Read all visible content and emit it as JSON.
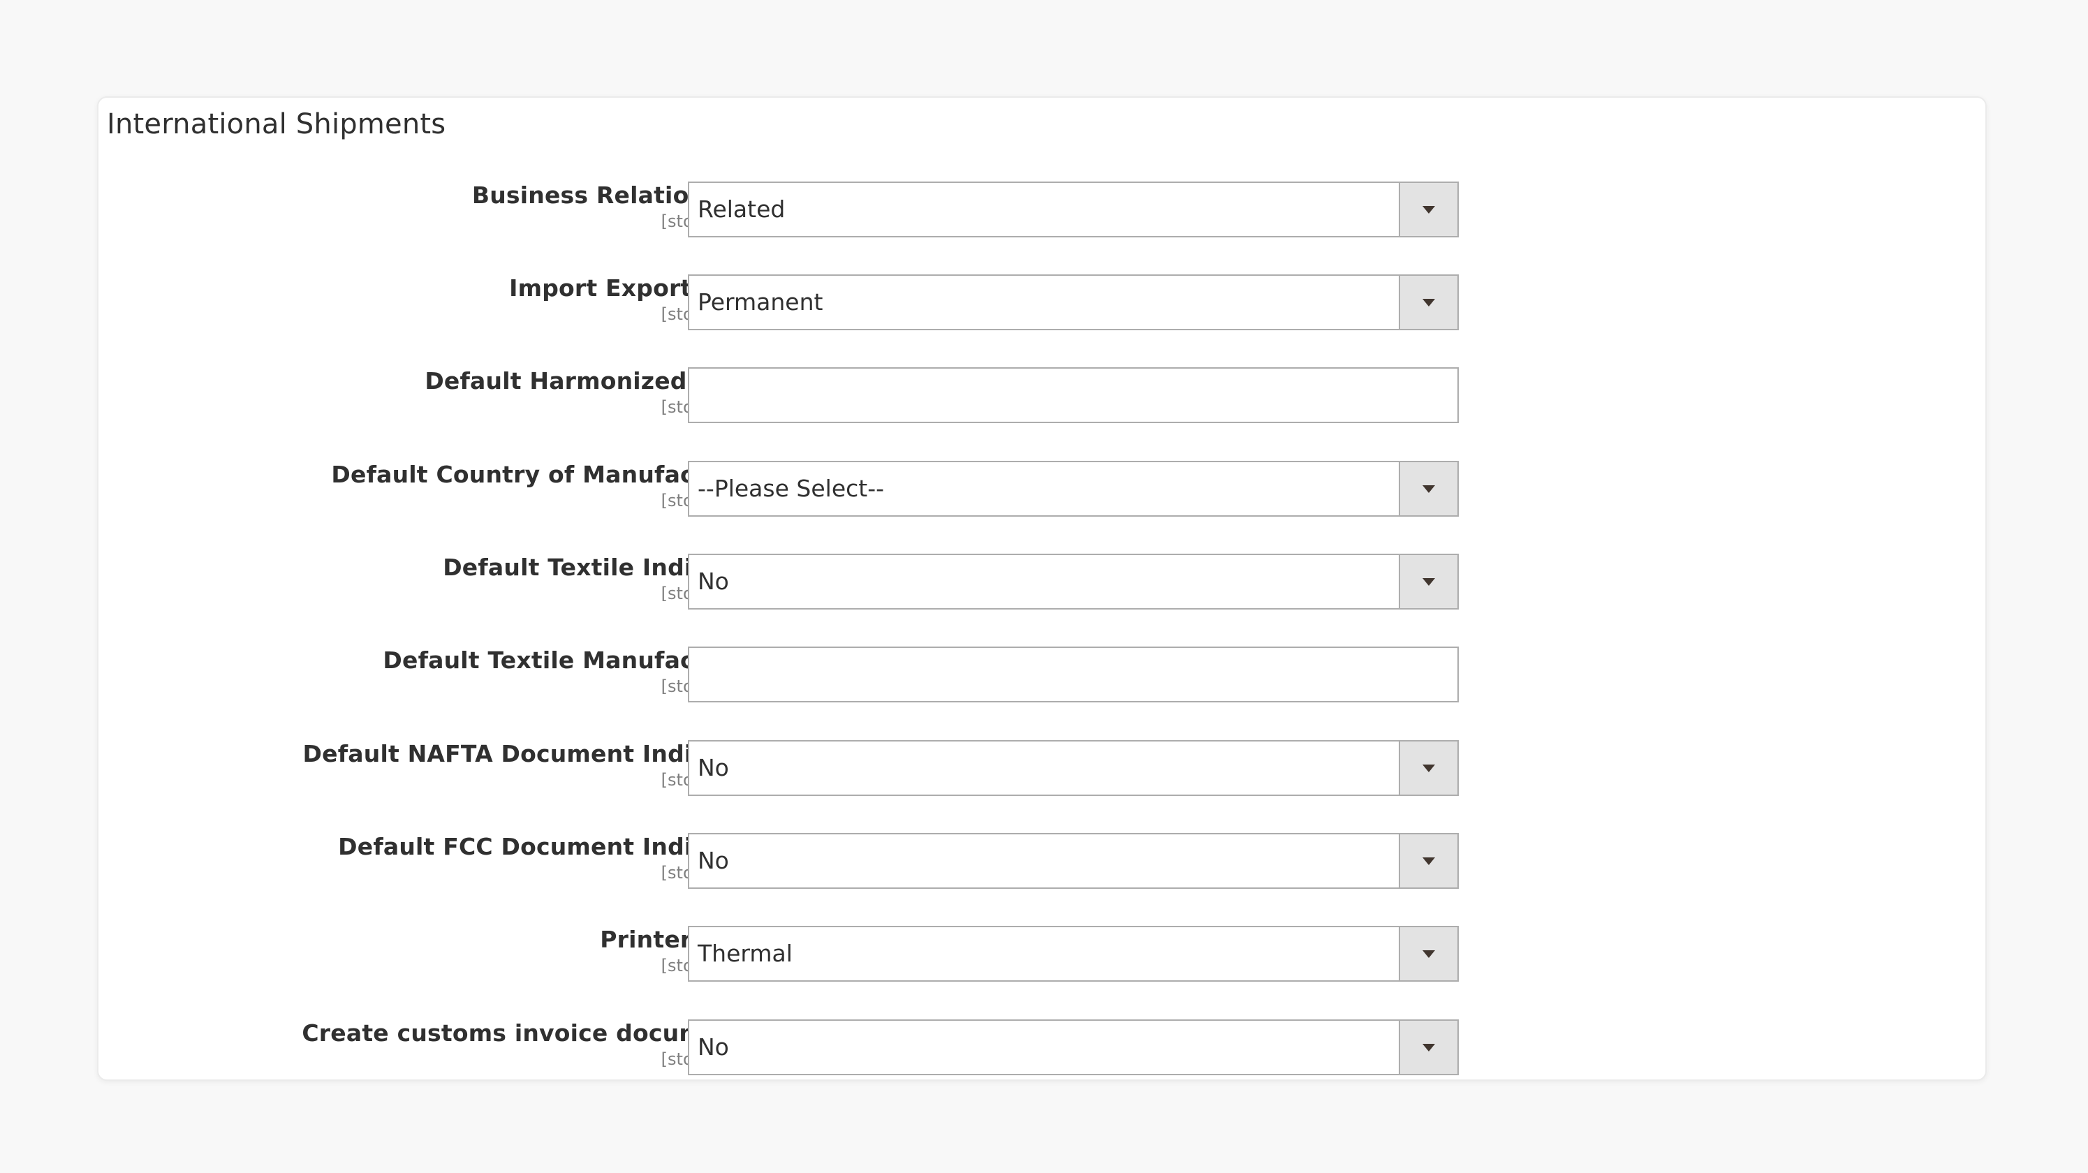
{
  "section": {
    "title": "International Shipments"
  },
  "fields": [
    {
      "label": "Business Relationship",
      "scope": "[store view]",
      "type": "select",
      "value": "Related"
    },
    {
      "label": "Import Export Type",
      "scope": "[store view]",
      "type": "select",
      "value": "Permanent"
    },
    {
      "label": "Default Harmonized Code",
      "scope": "[store view]",
      "type": "text",
      "value": ""
    },
    {
      "label": "Default Country of Manufacturer",
      "scope": "[store view]",
      "type": "select",
      "value": "--Please Select--"
    },
    {
      "label": "Default Textile Indicator",
      "scope": "[store view]",
      "type": "select",
      "value": "No"
    },
    {
      "label": "Default Textile Manufacturer",
      "scope": "[store view]",
      "type": "text",
      "value": ""
    },
    {
      "label": "Default NAFTA Document Indicator",
      "scope": "[store view]",
      "type": "select",
      "value": "No"
    },
    {
      "label": "Default FCC Document Indicator",
      "scope": "[store view]",
      "type": "select",
      "value": "No"
    },
    {
      "label": "Printer Type",
      "scope": "[store view]",
      "type": "select",
      "value": "Thermal"
    },
    {
      "label": "Create customs invoice documents",
      "scope": "[store view]",
      "type": "select",
      "value": "No"
    }
  ],
  "icons": {
    "dropdown": "chevron-down-icon"
  },
  "colors": {
    "page_background": "#f8f8f8",
    "panel_background": "#ffffff",
    "control_border": "#adadad",
    "arrow_box": "#e3e3e3",
    "label_text": "#303030",
    "scope_text": "#808080"
  }
}
